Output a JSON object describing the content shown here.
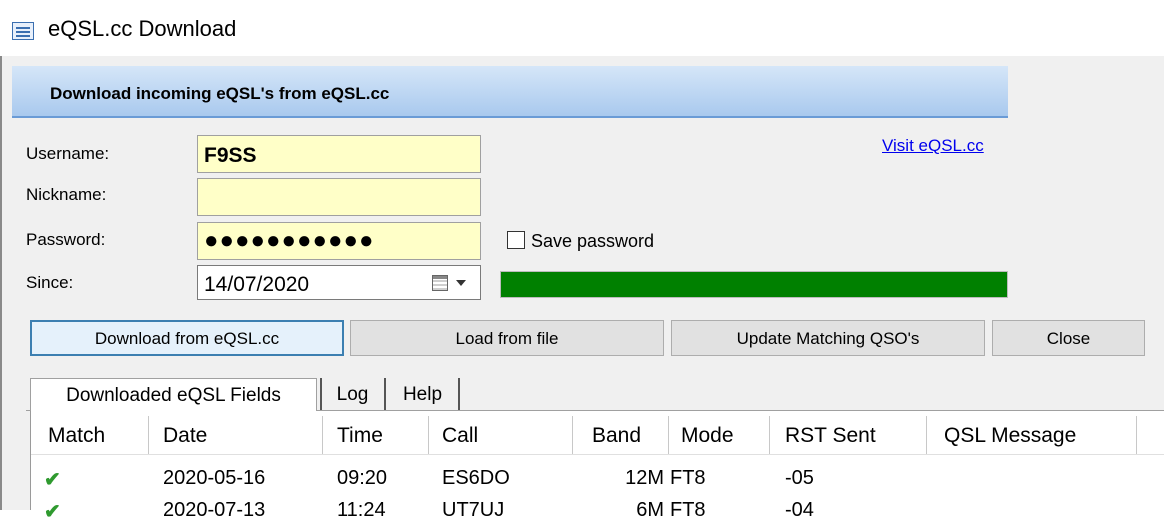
{
  "window": {
    "title": "eQSL.cc Download"
  },
  "banner": {
    "text": "Download incoming eQSL's from eQSL.cc"
  },
  "form": {
    "username_label": "Username:",
    "username_value": "F9SS",
    "nickname_label": "Nickname:",
    "nickname_value": "",
    "password_label": "Password:",
    "password_value": "●●●●●●●●●●●",
    "since_label": "Since:",
    "since_value": "14/07/2020",
    "visit_link": "Visit eQSL.cc",
    "save_password_label": "Save password",
    "save_password_checked": false,
    "progress": 1.0,
    "progress_color": "#008000"
  },
  "buttons": {
    "download": "Download from eQSL.cc",
    "load": "Load from file",
    "update": "Update Matching QSO's",
    "close": "Close"
  },
  "tabs": [
    {
      "label": "Downloaded eQSL Fields",
      "active": true
    },
    {
      "label": "Log",
      "active": false
    },
    {
      "label": "Help",
      "active": false
    }
  ],
  "table": {
    "columns": [
      "Match",
      "Date",
      "Time",
      "Call",
      "Band",
      "Mode",
      "RST Sent",
      "QSL Message"
    ],
    "rows": [
      {
        "match": "check-icon",
        "date": "2020-05-16",
        "time": "09:20",
        "call": "ES6DO",
        "band": "12M",
        "mode": "FT8",
        "rst": "-05",
        "message": ""
      },
      {
        "match": "check-icon",
        "date": "2020-07-13",
        "time": "11:24",
        "call": "UT7UJ",
        "band": "6M",
        "mode": "FT8",
        "rst": "-04",
        "message": ""
      }
    ]
  },
  "colors": {
    "accent": "#3c7fb1",
    "field_bg": "#ffffc8",
    "progress": "#008000",
    "check": "#2f9a2f"
  }
}
